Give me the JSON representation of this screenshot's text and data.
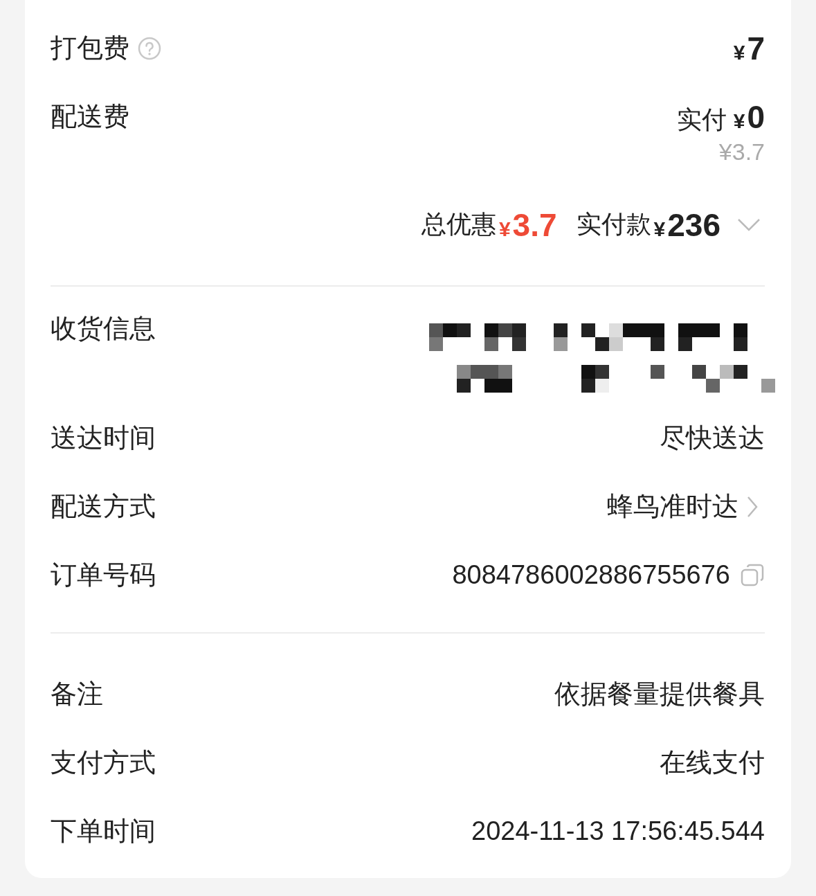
{
  "packing_fee": {
    "label": "打包费",
    "has_help": true,
    "currency": "¥",
    "amount": "7"
  },
  "delivery_fee": {
    "label": "配送费",
    "paid_label": "实付",
    "currency": "¥",
    "paid_amount": "0",
    "original": "¥3.7"
  },
  "summary": {
    "discount_label": "总优惠",
    "discount_currency": "¥",
    "discount": "3.7",
    "paid_label": "实付款",
    "paid_currency": "¥",
    "paid": "236",
    "expanded": false
  },
  "details": [
    {
      "label": "收货信息",
      "kind": "redacted"
    },
    {
      "label": "送达时间",
      "kind": "text",
      "value": "尽快送达"
    },
    {
      "label": "配送方式",
      "kind": "link",
      "value": "蜂鸟准时达"
    },
    {
      "label": "订单号码",
      "kind": "copy",
      "value": "8084786002886755676"
    }
  ],
  "extra": [
    {
      "label": "备注",
      "value": "依据餐量提供餐具"
    },
    {
      "label": "支付方式",
      "value": "在线支付"
    },
    {
      "label": "下单时间",
      "value": "2024-11-13 17:56:45.544"
    }
  ]
}
